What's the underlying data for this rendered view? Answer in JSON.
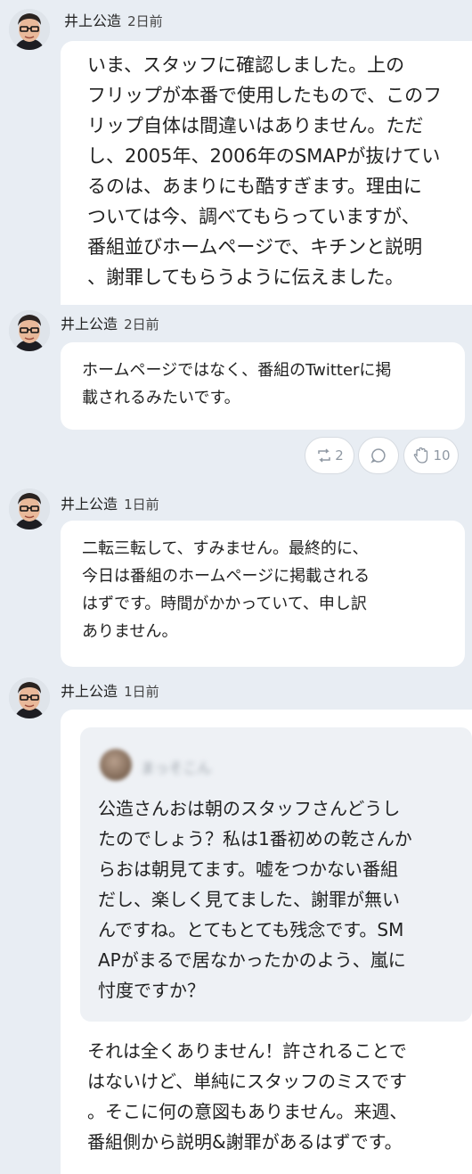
{
  "posts": [
    {
      "author": "井上公造",
      "time": "2日前",
      "lines": [
        "いま、スタッフに確認しました。上の",
        "フリップが本番で使用したもので、このフ",
        "リップ自体は間違いはありません。ただ",
        "し、2005年、2006年のSMAPが抜けてい",
        "るのは、あまりにも酷すぎます。理由に",
        "ついては今、調べてもらっていますが、",
        "番組並びホームページで、キチンと説明",
        "、謝罪してもらうように伝えました。"
      ]
    },
    {
      "author": "井上公造",
      "time": "2日前",
      "lines": [
        "ホームページではなく、番組のTwitterに掲",
        "載されるみたいです。"
      ],
      "reactions": {
        "repost_count": "2",
        "clap_count": "10"
      }
    },
    {
      "author": "井上公造",
      "time": "1日前",
      "lines": [
        "二転三転して、すみません。最終的に、",
        "今日は番組のホームページに掲載される",
        "はずです。時間がかかっていて、申し訳",
        "ありません。"
      ]
    },
    {
      "author": "井上公造",
      "time": "1日前",
      "quote": {
        "name": "まっそこん",
        "lines": [
          "公造さんおは朝のスタッフさんどうし",
          "たのでしょう？私は1番初めの乾さんか",
          "らおは朝見てます。嘘をつかない番組",
          "だし、楽しく見てました、謝罪が無い",
          "んですね。とてもとても残念です。SM",
          "APがまるで居なかったかのよう、嵐に",
          "忖度ですか？"
        ]
      },
      "lines": [
        "それは全くありません！許されることで",
        "はないけど、単純にスタッフのミスです",
        "。そこに何の意図もありません。来週、",
        "番組側から説明&謝罪があるはずです。"
      ]
    }
  ],
  "icons": {
    "repost": "repost-icon",
    "comment": "comment-icon",
    "clap": "clap-icon"
  }
}
